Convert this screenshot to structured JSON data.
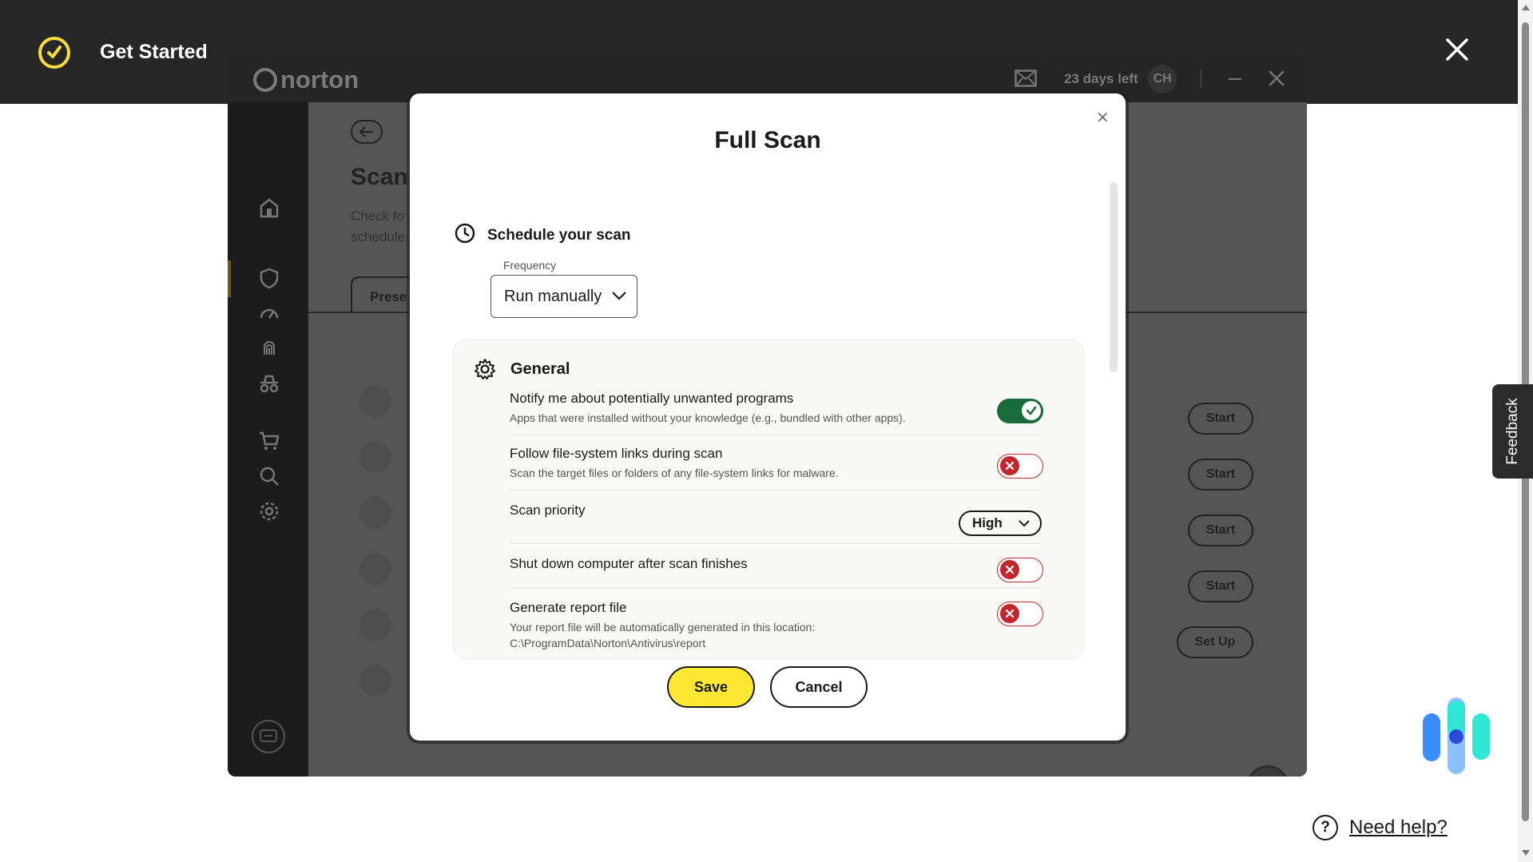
{
  "outer": {
    "title": "Get Started",
    "need_help": "Need help?",
    "feedback": "Feedback"
  },
  "norton": {
    "brand": "norton",
    "trial": "23 days left",
    "avatar": "CH",
    "page_title": "Scan",
    "page_sub_1": "Check fo",
    "page_sub_2": "schedule",
    "tab_label": "Prese",
    "row_buttons": [
      "Start",
      "Start",
      "Start",
      "Start",
      "Set Up"
    ]
  },
  "modal": {
    "title": "Full Scan",
    "schedule_label": "Schedule your scan",
    "frequency_label": "Frequency",
    "frequency_value": "Run manually",
    "general_label": "General",
    "options": [
      {
        "title": "Notify me about potentially unwanted programs",
        "desc": "Apps that were installed without your knowledge (e.g., bundled with other apps).",
        "state": "on"
      },
      {
        "title": "Follow file-system links during scan",
        "desc": "Scan the target files or folders of any file-system links for malware.",
        "state": "off"
      },
      {
        "title": "Scan priority",
        "value": "High"
      },
      {
        "title": "Shut down computer after scan finishes",
        "state": "off"
      },
      {
        "title": "Generate report file",
        "desc": "Your report file will be automatically generated in this location:",
        "desc2": "C:\\ProgramData\\Norton\\Antivirus\\report",
        "state": "off"
      }
    ],
    "save": "Save",
    "cancel": "Cancel"
  },
  "colors": {
    "accent_yellow": "#ffe833",
    "toggle_on": "#1a6b3a",
    "toggle_off": "#c4262e",
    "header_bg": "#262626"
  },
  "icons": [
    "check-circle-logo-icon",
    "close-icon",
    "mail-icon",
    "home-icon",
    "shield-icon",
    "speedometer-icon",
    "fingerprint-icon",
    "incognito-icon",
    "cart-icon",
    "search-icon",
    "gear-icon",
    "chat-icon",
    "clock-icon",
    "chevron-down-icon",
    "question-icon"
  ]
}
